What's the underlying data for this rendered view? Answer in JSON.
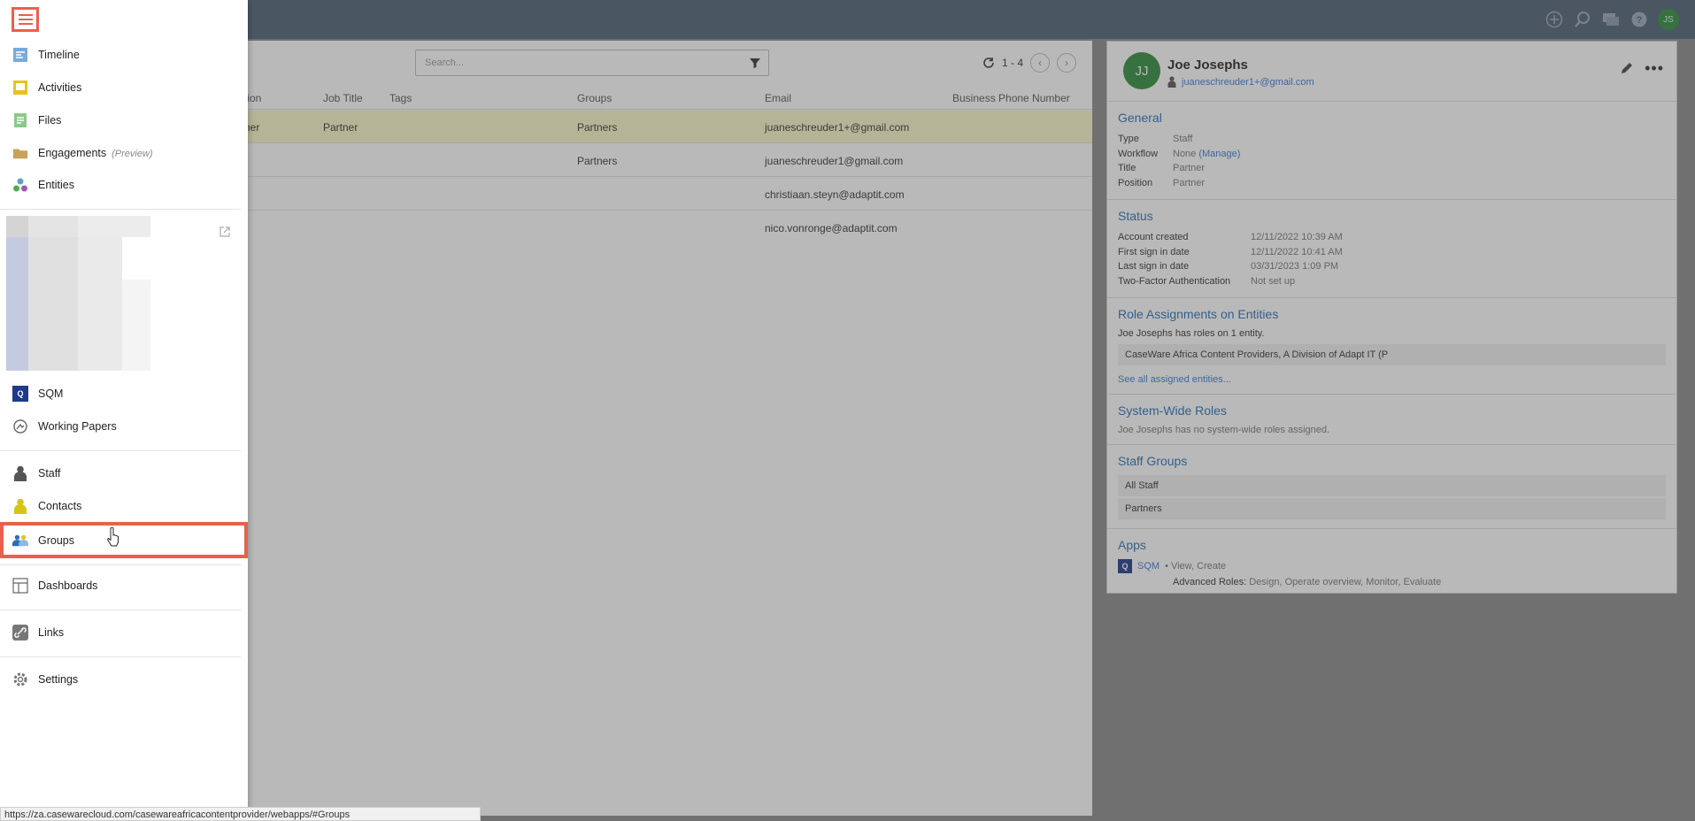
{
  "menu": {
    "items": [
      {
        "label": "Timeline"
      },
      {
        "label": "Activities"
      },
      {
        "label": "Files"
      },
      {
        "label": "Engagements",
        "suffix": "(Preview)"
      },
      {
        "label": "Entities"
      },
      {
        "label": "SQM"
      },
      {
        "label": "Working Papers"
      },
      {
        "label": "Staff"
      },
      {
        "label": "Contacts"
      },
      {
        "label": "Groups"
      },
      {
        "label": "Dashboards"
      },
      {
        "label": "Links"
      },
      {
        "label": "Settings"
      }
    ],
    "sqm_badge": "Q"
  },
  "topbar": {
    "user_initials": "JS"
  },
  "list": {
    "search_placeholder": "Search...",
    "page_range": "1 - 4",
    "columns": [
      "tion",
      "Job Title",
      "Tags",
      "Groups",
      "Email",
      "Business Phone Number"
    ],
    "rows": [
      {
        "position": "ner",
        "job_title": "Partner",
        "groups": "Partners",
        "email": "juaneschreuder1+@gmail.com"
      },
      {
        "position": "",
        "job_title": "",
        "groups": "Partners",
        "email": "juaneschreuder1@gmail.com"
      },
      {
        "position": "",
        "job_title": "",
        "groups": "",
        "email": "christiaan.steyn@adaptit.com"
      },
      {
        "position": "",
        "job_title": "",
        "groups": "",
        "email": "nico.vonronge@adaptit.com"
      }
    ]
  },
  "details": {
    "initials": "JJ",
    "name": "Joe Josephs",
    "email": "juaneschreuder1+@gmail.com",
    "general": {
      "title": "General",
      "type_k": "Type",
      "type_v": "Staff",
      "workflow_k": "Workflow",
      "workflow_v": "None",
      "workflow_link": "(Manage)",
      "title_k": "Title",
      "title_v": "Partner",
      "position_k": "Position",
      "position_v": "Partner"
    },
    "status": {
      "title": "Status",
      "rows": [
        {
          "k": "Account created",
          "v": "12/11/2022 10:39 AM"
        },
        {
          "k": "First sign in date",
          "v": "12/11/2022 10:41 AM"
        },
        {
          "k": "Last sign in date",
          "v": "03/31/2023 1:09 PM"
        },
        {
          "k": "Two-Factor Authentication",
          "v": "Not set up"
        }
      ]
    },
    "roles": {
      "title": "Role Assignments on Entities",
      "summary": "Joe Josephs has roles on 1 entity.",
      "entity": "CaseWare Africa Content Providers, A Division of Adapt IT (P",
      "see_all": "See all assigned entities..."
    },
    "system_roles": {
      "title": "System-Wide Roles",
      "text": "Joe Josephs has no system-wide roles assigned."
    },
    "staff_groups": {
      "title": "Staff Groups",
      "groups": [
        "All Staff",
        "Partners"
      ]
    },
    "apps": {
      "title": "Apps",
      "app_badge": "Q",
      "app_name": "SQM",
      "permissions": "• View, Create",
      "advanced_label": "Advanced Roles:",
      "advanced_roles": "Design, Operate overview, Monitor, Evaluate"
    }
  },
  "status_url": "https://za.casewarecloud.com/casewareafricacontentprovider/webapps/#Groups",
  "colors": {
    "accent": "#e8614a",
    "header": "#4d5f73",
    "link": "#3a7bd5",
    "avatar": "#2e8b3a"
  }
}
